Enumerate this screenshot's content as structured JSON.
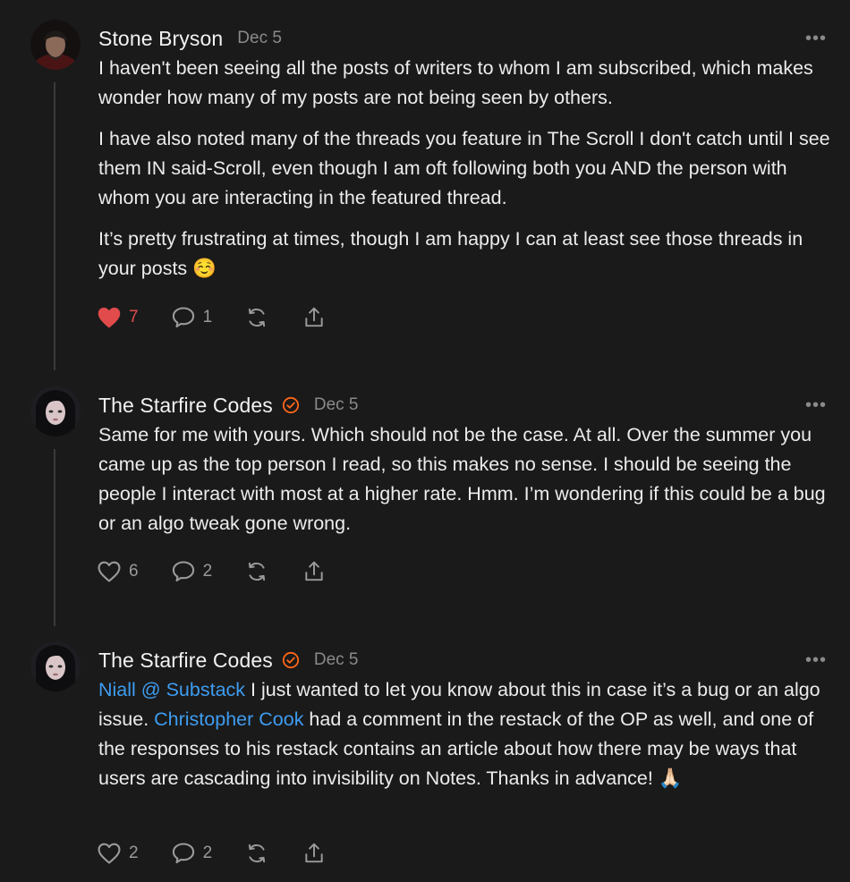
{
  "comments": [
    {
      "author": "Stone Bryson",
      "date": "Dec 5",
      "verified": false,
      "paragraphs": [
        "I haven't been seeing all the posts of writers to whom I am subscribed, which makes wonder how many of my posts are not being seen by others.",
        "I have also noted many of the threads you feature in The Scroll I don't catch until I see them IN said-Scroll, even though I am oft following both you AND the person with whom you are interacting in the featured thread.",
        "It’s pretty frustrating at times, though I am happy I can at least see those threads in your posts ☺️"
      ],
      "likes": "7",
      "liked": true,
      "replies": "1"
    },
    {
      "author": "The Starfire Codes",
      "date": "Dec 5",
      "verified": true,
      "paragraphs": [
        "Same for me with yours. Which should not be the case. At all. Over the summer you came up as the top person I read, so this makes no sense. I should be seeing the people I interact with most at a higher rate. Hmm. I’m wondering if this could be a bug or an algo tweak gone wrong."
      ],
      "likes": "6",
      "liked": false,
      "replies": "2"
    },
    {
      "author": "The Starfire Codes",
      "date": "Dec 5",
      "verified": true,
      "mention1": "Niall @ Substack",
      "text1": " I just wanted to let you know about this in case it’s a bug or an algo issue. ",
      "mention2": "Christopher Cook",
      "text2": " had a comment in the restack of the OP as well, and one of the responses to his restack contains an article about how there may be ways that users are cascading into invisibility on Notes. Thanks in advance! 🙏🏻",
      "likes": "2",
      "liked": false,
      "replies": "2"
    }
  ],
  "more_label": "•••",
  "colors": {
    "background": "#1a1a1a",
    "mention": "#3e9cf0",
    "liked": "#e24b4b",
    "verified": "#ff6719"
  }
}
